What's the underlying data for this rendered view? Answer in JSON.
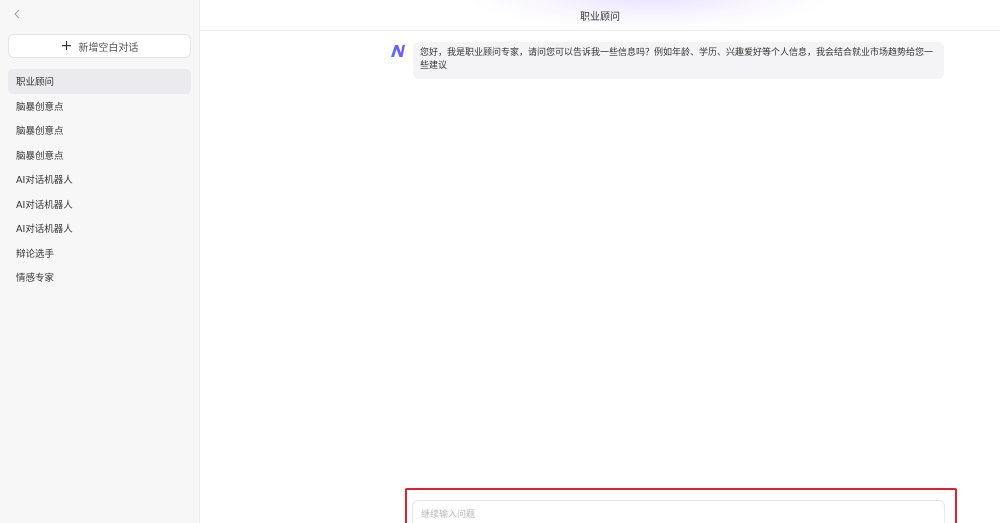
{
  "sidebar": {
    "new_chat_label": "新增空白对话",
    "items": [
      {
        "label": "职业顾问",
        "active": true
      },
      {
        "label": "脑暴创意点"
      },
      {
        "label": "脑暴创意点"
      },
      {
        "label": "脑暴创意点"
      },
      {
        "label": "AI对话机器人"
      },
      {
        "label": "AI对话机器人"
      },
      {
        "label": "AI对话机器人"
      },
      {
        "label": "辩论选手"
      },
      {
        "label": "情感专家"
      }
    ]
  },
  "header": {
    "title": "职业顾问"
  },
  "chat": {
    "messages": [
      {
        "role": "bot",
        "text": "您好，我是职业顾问专家，请问您可以告诉我一些信息吗？例如年龄、学历、兴趣爱好等个人信息，我会结合就业市场趋势给您一些建议"
      }
    ]
  },
  "input": {
    "placeholder": "继续输入问题",
    "value": ""
  },
  "colors": {
    "highlight": "#e0202a",
    "logo_left": "#3a7bff",
    "logo_right": "#8a4dff"
  },
  "icons": {
    "back": "chevron-left-icon",
    "new_chat": "plus-icon",
    "bot": "bot-logo-icon"
  }
}
